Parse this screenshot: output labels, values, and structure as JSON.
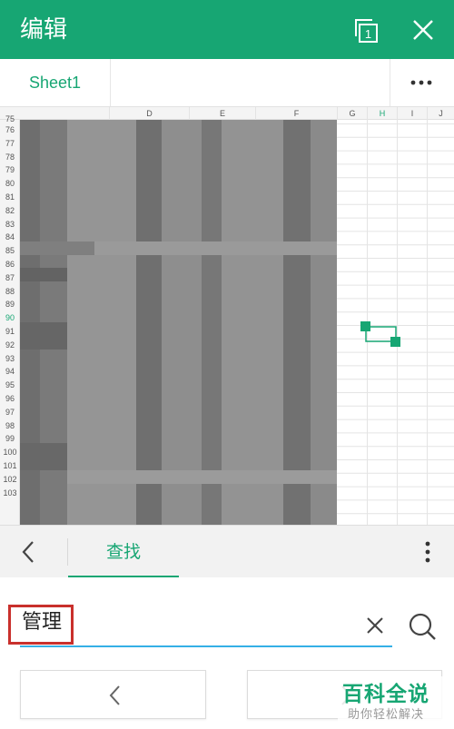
{
  "header": {
    "title": "编辑",
    "pages_icon": "pages-icon",
    "pages_count": "1",
    "close_icon": "close-icon",
    "background": "#17a673"
  },
  "sheet_tabs": {
    "items": [
      "Sheet1"
    ],
    "more_icon": "more-horizontal-icon"
  },
  "grid": {
    "columns": [
      "D",
      "E",
      "F",
      "G",
      "H",
      "I",
      "J"
    ],
    "active_column": "H",
    "rows": [
      "75",
      "76",
      "77",
      "78",
      "79",
      "80",
      "81",
      "82",
      "83",
      "84",
      "85",
      "86",
      "87",
      "88",
      "89",
      "90",
      "91",
      "92",
      "93",
      "94",
      "95",
      "96",
      "97",
      "98",
      "99",
      "100",
      "101",
      "102",
      "103"
    ],
    "active_row": "90",
    "selection_handles_icon": "cell-selection-handles-icon"
  },
  "find_bar": {
    "back_icon": "chevron-left-icon",
    "tab_label": "查找",
    "menu_icon": "more-vertical-icon"
  },
  "search": {
    "value": "管理",
    "clear_icon": "clear-icon",
    "search_icon": "search-icon",
    "underline_color": "#35b0e6",
    "highlight_color": "#c9302c"
  },
  "navigation": {
    "prev_icon": "chevron-left-icon",
    "next_icon": "chevron-right-icon"
  },
  "watermark": {
    "main": "百科全说",
    "sub": "助你轻松解决"
  },
  "colors": {
    "accent": "#17a673",
    "text_dark": "#222222"
  }
}
